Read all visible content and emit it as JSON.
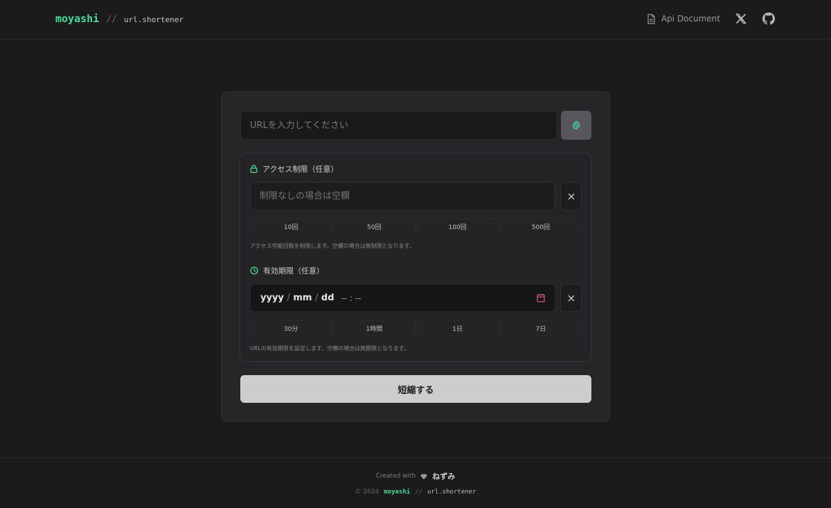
{
  "header": {
    "brand_name": "moyashi",
    "brand_sep": "//",
    "brand_sub": "url.shortener",
    "nav": {
      "doc_label": "Api Document",
      "doc_icon": "document-icon",
      "x_icon": "x-logo-icon",
      "github_icon": "github-icon"
    }
  },
  "form": {
    "url_placeholder": "URLを入力してください",
    "settings_icon": "gear-icon",
    "access": {
      "title": "アクセス制限（任意）",
      "icon": "lock-icon",
      "placeholder": "制限なしの場合は空欄",
      "presets": [
        "10回",
        "50回",
        "100回",
        "500回"
      ],
      "hint": "アクセス可能回数を制限します。空欄の場合は無制限となります。"
    },
    "expiry": {
      "title": "有効期限（任意）",
      "icon": "clock-icon",
      "date_yyyy": "yyyy",
      "date_mm": "mm",
      "date_dd": "dd",
      "date_slash": "/",
      "time_display": "-- : --",
      "presets": [
        "30分",
        "1時間",
        "1日",
        "7日"
      ],
      "hint": "URLの有効期限を設定します。空欄の場合は無期限となります。"
    },
    "submit_label": "短縮する"
  },
  "footer": {
    "created_with": "Created with",
    "author": "ねずみ",
    "copyright": "© 2024",
    "brand_name": "moyashi",
    "brand_sep": "//",
    "brand_sub": "url.shortener"
  },
  "colors": {
    "accent": "#4ade9a",
    "background": "#1b1b1d",
    "card": "#262628",
    "calendar_icon": "#d9607a"
  }
}
